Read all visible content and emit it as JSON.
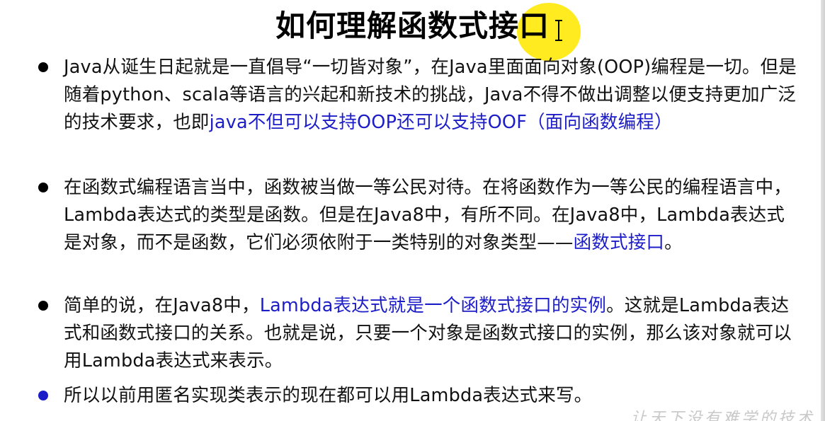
{
  "title": "如何理解函数式接口",
  "bullets": [
    {
      "bullet_color": "#000000",
      "parts": [
        "Java从诞生日起就是一直倡导“一切皆对象”，在Java里面面向对象(OOP)编程是一切。但是随着python、scala等语言的兴起和新技术的挑战，Java不得不做出调整以便支持更加广泛的技术要求，也即",
        "java不但可以支持OOP还可以支持OOF（面向函数编程）"
      ]
    },
    {
      "bullet_color": "#000000",
      "parts": [
        "在函数式编程语言当中，函数被当做一等公民对待。在将函数作为一等公民的编程语言中，Lambda表达式的类型是函数。但是在Java8中，有所不同。在Java8中，Lambda表达式是对象，而不是函数，它们必须依附于一类特别的对象类型——",
        "函数式接口",
        "。"
      ]
    },
    {
      "bullet_color": "#000000",
      "parts": [
        "简单的说，在Java8中，",
        "Lambda表达式就是一个函数式接口的实例",
        "。这就是Lambda表达式和函数式接口的关系。也就是说，只要一个对象是函数式接口的实例，那么该对象就可以用Lambda表达式来表示。"
      ]
    },
    {
      "bullet_color": "#1d1dc8",
      "parts": [
        "所以以前用匿名实现类表示的现在都可以用Lambda表达式来写。"
      ]
    }
  ],
  "watermark": "让天下没有难学的技术",
  "colors": {
    "text": "#111111",
    "emphasis_blue": "#1d1dc8",
    "cursor_highlight": "#ffe800"
  }
}
